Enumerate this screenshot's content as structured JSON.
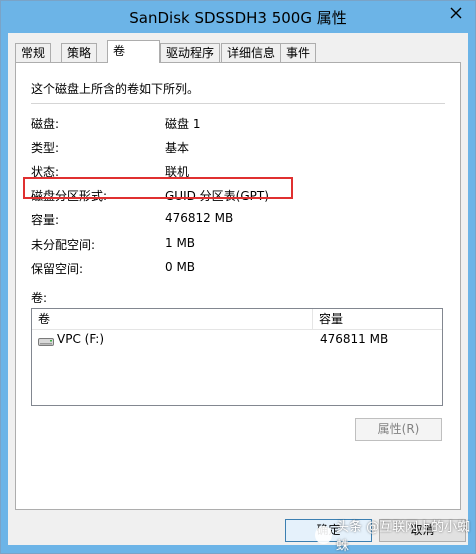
{
  "window": {
    "title": "SanDisk SDSSDH3 500G 属性"
  },
  "tabs": [
    {
      "label": "常规",
      "active": false
    },
    {
      "label": "策略",
      "active": false
    },
    {
      "label": "卷",
      "active": true
    },
    {
      "label": "驱动程序",
      "active": false
    },
    {
      "label": "详细信息",
      "active": false
    },
    {
      "label": "事件",
      "active": false
    }
  ],
  "panel": {
    "description": "这个磁盘上所含的卷如下所列。",
    "properties": [
      {
        "label": "磁盘:",
        "value": "磁盘 1"
      },
      {
        "label": "类型:",
        "value": "基本"
      },
      {
        "label": "状态:",
        "value": "联机"
      },
      {
        "label": "磁盘分区形式:",
        "value": "GUID 分区表(GPT)"
      },
      {
        "label": "容量:",
        "value": "476812 MB"
      },
      {
        "label": "未分配空间:",
        "value": "1 MB"
      },
      {
        "label": "保留空间:",
        "value": "0 MB"
      }
    ],
    "volumes_label": "卷:",
    "volume_list": {
      "columns": [
        "卷",
        "容量"
      ],
      "rows": [
        {
          "name": "VPC (F:)",
          "capacity": "476811 MB",
          "icon": "drive-icon"
        }
      ]
    },
    "properties_button": "属性(R)"
  },
  "buttons": {
    "ok": "确定",
    "cancel": "取消"
  },
  "watermark": {
    "text": "头条 @互联网上的小蜘蛛"
  },
  "colors": {
    "titlebar": "#6cb4e7",
    "highlight_border": "#e03030"
  }
}
